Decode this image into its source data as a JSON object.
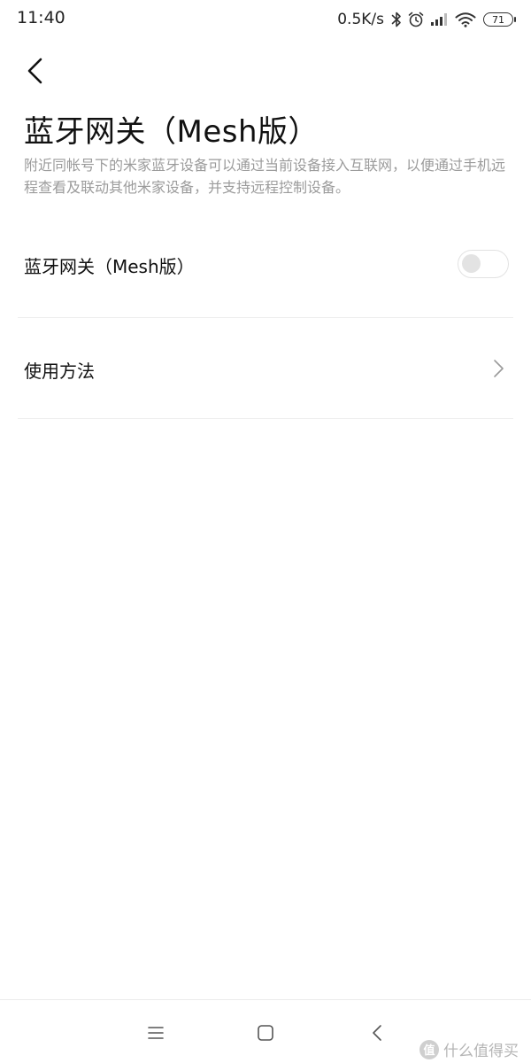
{
  "status_bar": {
    "time": "11:40",
    "net_speed": "0.5K/s",
    "battery_level": "71",
    "icons": [
      "bluetooth-icon",
      "alarm-icon",
      "signal-icon",
      "wifi-icon",
      "battery-icon"
    ]
  },
  "header": {
    "back_icon": "chevron-left-icon",
    "title": "蓝牙网关（Mesh版）",
    "description": "附近同帐号下的米家蓝牙设备可以通过当前设备接入互联网，以便通过手机远程查看及联动其他米家设备，并支持远程控制设备。"
  },
  "settings": {
    "gateway": {
      "label": "蓝牙网关（Mesh版）",
      "enabled": false
    },
    "usage": {
      "label": "使用方法",
      "icon": "chevron-right-icon"
    }
  },
  "nav_bar": {
    "icons": [
      "menu-icon",
      "home-icon",
      "back-icon"
    ]
  },
  "watermark": {
    "badge": "值",
    "text": "什么值得买"
  },
  "colors": {
    "text_primary": "#111111",
    "text_secondary": "#9b9b9b",
    "divider": "#eeeeee",
    "toggle_off": "#e3e3e3"
  }
}
